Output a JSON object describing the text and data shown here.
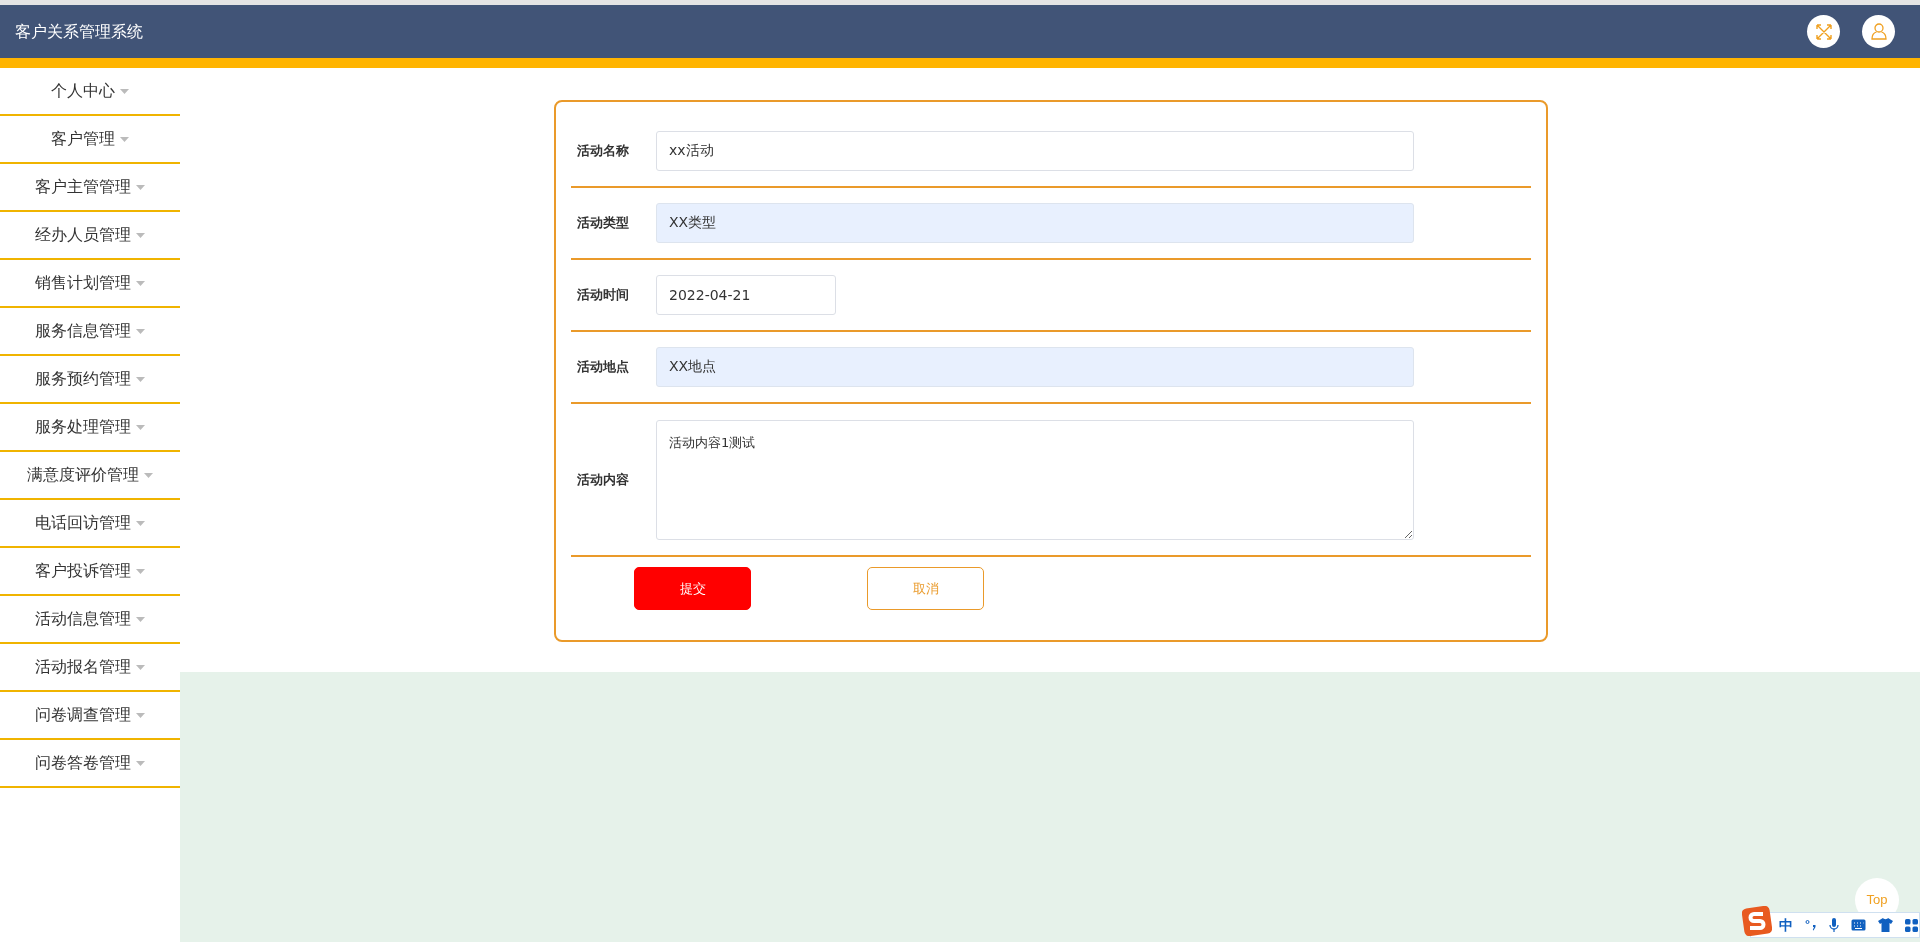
{
  "header": {
    "title": "客户关系管理系统"
  },
  "sidebar": {
    "items": [
      {
        "label": "个人中心"
      },
      {
        "label": "客户管理"
      },
      {
        "label": "客户主管管理"
      },
      {
        "label": "经办人员管理"
      },
      {
        "label": "销售计划管理"
      },
      {
        "label": "服务信息管理"
      },
      {
        "label": "服务预约管理"
      },
      {
        "label": "服务处理管理"
      },
      {
        "label": "满意度评价管理"
      },
      {
        "label": "电话回访管理"
      },
      {
        "label": "客户投诉管理"
      },
      {
        "label": "活动信息管理"
      },
      {
        "label": "活动报名管理"
      },
      {
        "label": "问卷调查管理"
      },
      {
        "label": "问卷答卷管理"
      }
    ]
  },
  "form": {
    "fields": [
      {
        "kind": "text",
        "label": "活动名称",
        "value": "xx活动",
        "autofilled": false
      },
      {
        "kind": "text",
        "label": "活动类型",
        "value": "XX类型",
        "autofilled": true
      },
      {
        "kind": "date",
        "label": "活动时间",
        "value": "2022-04-21",
        "autofilled": false
      },
      {
        "kind": "text",
        "label": "活动地点",
        "value": "XX地点",
        "autofilled": true
      },
      {
        "kind": "textarea",
        "label": "活动内容",
        "value": "活动内容1测试",
        "autofilled": false
      }
    ],
    "buttons": [
      {
        "kind": "primary",
        "label": "提交"
      },
      {
        "kind": "outline",
        "label": "取消"
      }
    ]
  },
  "back_to_top": {
    "label": "Top"
  },
  "ime_toolbar": {
    "mode": "中"
  }
}
